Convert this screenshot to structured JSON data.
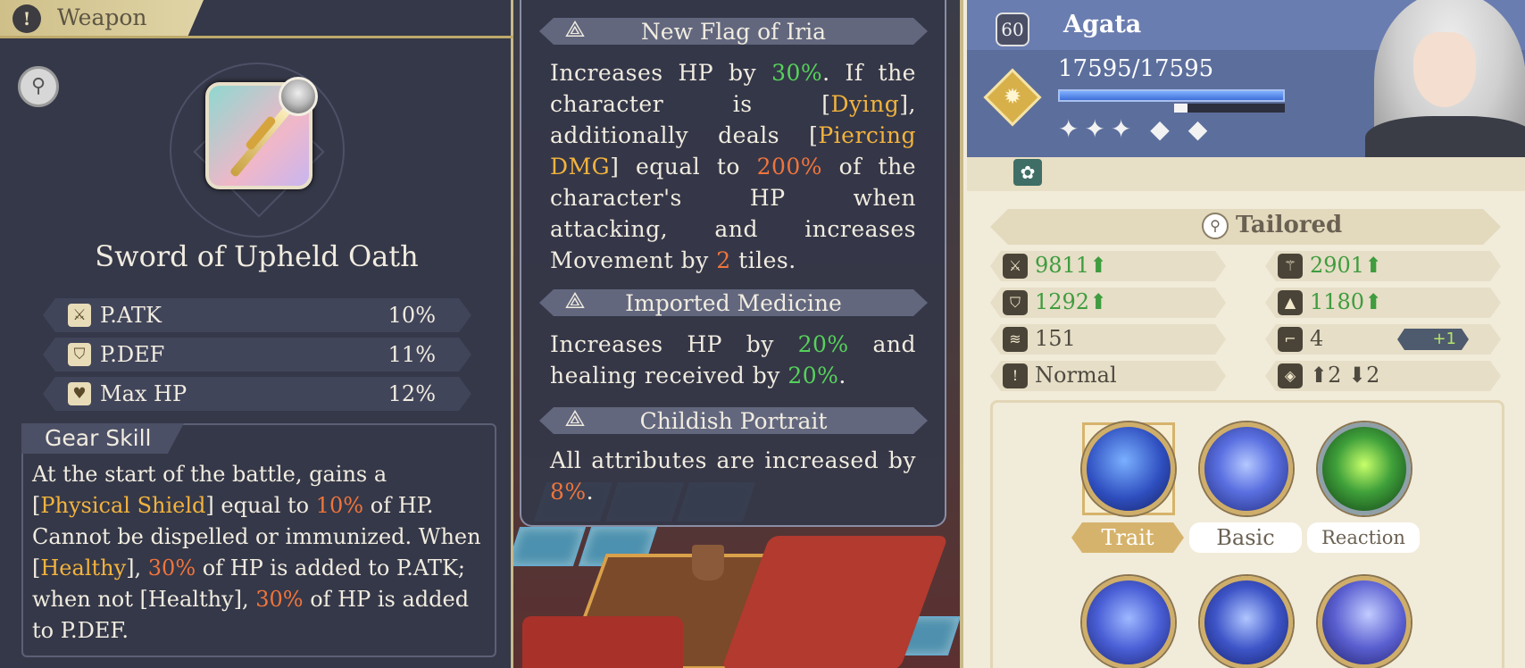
{
  "left_panel": {
    "header": "Weapon",
    "weapon_name": "Sword of Upheld Oath",
    "stats": [
      {
        "icon": "sword-icon",
        "name": "P.ATK",
        "value": "10%"
      },
      {
        "icon": "shield-icon",
        "name": "P.DEF",
        "value": "11%"
      },
      {
        "icon": "heart-icon",
        "name": "Max HP",
        "value": "12%"
      }
    ],
    "gear_skill": {
      "title": "Gear Skill",
      "t1": "At the start of the battle, gains a [",
      "h1": "Physical Shield",
      "t2": "] equal to ",
      "h2": "10%",
      "t3": " of HP. Cannot be dispelled or immunized. When [",
      "h3": "Healthy",
      "t4": "], ",
      "h4": "30%",
      "t5": " of HP is added to P.ATK; when not [Healthy], ",
      "h5": "30%",
      "t6": " of HP is added to P.DEF."
    }
  },
  "tooltip": {
    "sections": [
      {
        "title": "New Flag of Iria",
        "t1": "Increases HP by ",
        "h1": "30%",
        "t2": ". If the character is [",
        "h2": "Dying",
        "t3": "], additionally deals [",
        "h3": "Piercing DMG",
        "t4": "] equal to ",
        "h4": "200%",
        "t5": " of the character's HP when attacking, and increases Movement by ",
        "h5": "2",
        "t6": " tiles."
      },
      {
        "title": "Imported Medicine",
        "t1": "Increases HP by ",
        "h1": "20%",
        "t2": " and healing received by ",
        "h2": "20%",
        "t3": "."
      },
      {
        "title": "Childish Portrait",
        "t1": "All attributes are increased by ",
        "h1": "8%",
        "t2": "."
      }
    ]
  },
  "character": {
    "level": "60",
    "name": "Agata",
    "hp": "17595/17595",
    "hp_fraction": 1.0,
    "xp_fraction": 0.12,
    "stars": "✦✦✦ ◆ ◆",
    "mode": "Tailored",
    "stats": [
      {
        "icon": "sword-icon",
        "value": "9811",
        "arrow": "⬆",
        "color": "green"
      },
      {
        "icon": "staff-icon",
        "value": "2901",
        "arrow": "⬆",
        "color": "green"
      },
      {
        "icon": "shield-icon",
        "value": "1292",
        "arrow": "⬆",
        "color": "green"
      },
      {
        "icon": "hat-icon",
        "value": "1180",
        "arrow": "⬆",
        "color": "green"
      },
      {
        "icon": "wing-icon",
        "value": "151",
        "arrow": "",
        "color": "dark"
      },
      {
        "icon": "boot-icon",
        "value": "4",
        "arrow": "",
        "color": "dark",
        "badge": "+1"
      },
      {
        "icon": "person-icon",
        "value": "Normal",
        "arrow": "",
        "color": "dark"
      },
      {
        "icon": "range-icon",
        "value": "⬆2 ⬇2",
        "arrow": "",
        "color": "dark"
      }
    ],
    "skills": [
      {
        "label": "Trait",
        "active": true
      },
      {
        "label": "Basic",
        "active": false
      },
      {
        "label": "Reaction",
        "active": false
      }
    ]
  },
  "colors": {
    "highlight_yellow": "#f3b33d",
    "highlight_orange": "#f0743c",
    "highlight_green": "#56d25a",
    "stat_green": "#3f9c3f"
  }
}
